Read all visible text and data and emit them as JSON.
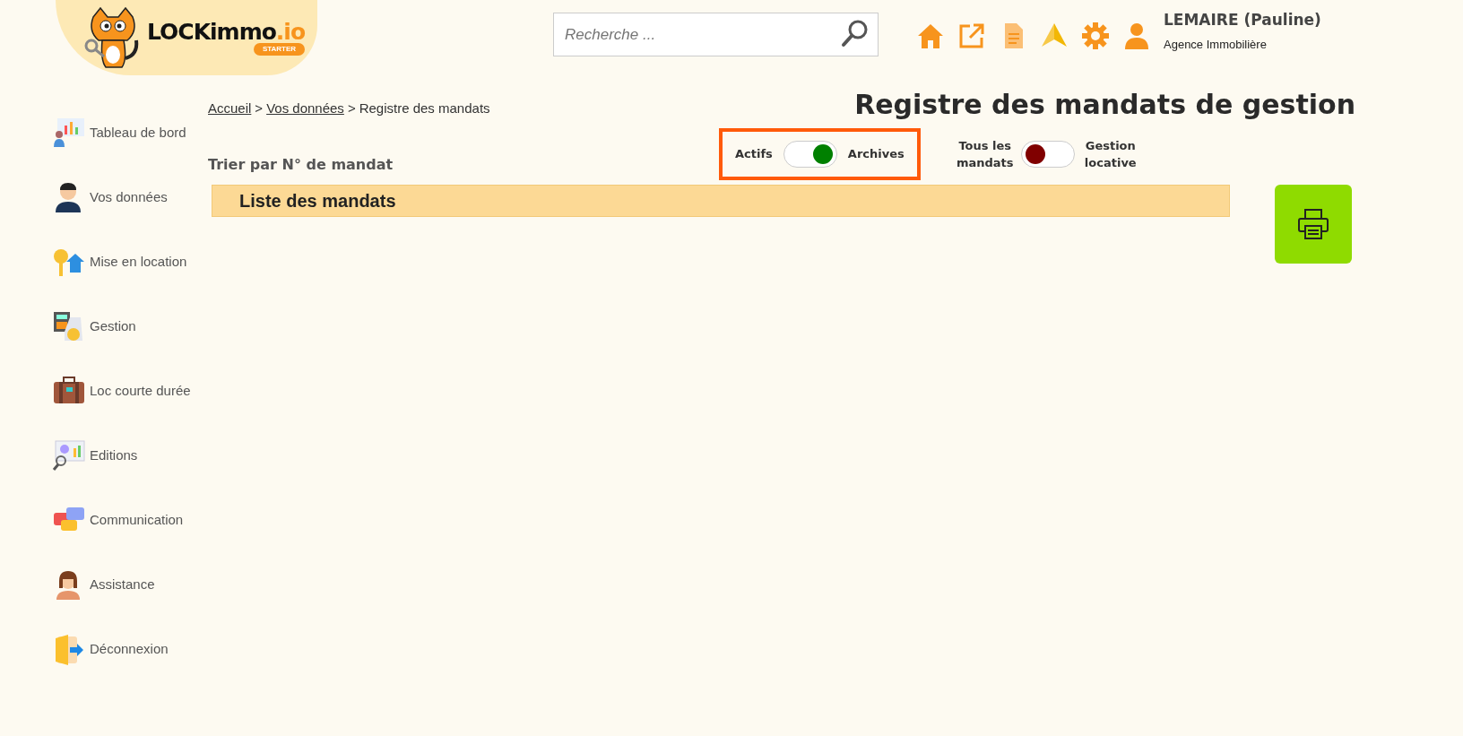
{
  "logo": {
    "name": "LOCKimmo",
    "suffix": ".io",
    "badge": "STARTER"
  },
  "search": {
    "placeholder": "Recherche ..."
  },
  "user": {
    "name": "LEMAIRE (Pauline)",
    "role": "Agence Immobilière"
  },
  "sidebar": {
    "items": [
      {
        "label": "Tableau de bord"
      },
      {
        "label": "Vos données"
      },
      {
        "label": "Mise en location"
      },
      {
        "label": "Gestion"
      },
      {
        "label": "Loc courte durée"
      },
      {
        "label": "Editions"
      },
      {
        "label": "Communication"
      },
      {
        "label": "Assistance"
      },
      {
        "label": "Déconnexion"
      }
    ]
  },
  "breadcrumb": [
    {
      "label": "Accueil",
      "link": true
    },
    {
      "label": "Vos données",
      "link": true
    },
    {
      "label": "Registre des mandats",
      "link": false
    }
  ],
  "separator": ">",
  "page_title": "Registre des mandats de gestion",
  "sort_label": "Trier par N° de mandat",
  "toggles": [
    {
      "left": "Actifs",
      "right": "Archives",
      "on": true,
      "color": "#008000",
      "highlighted": true
    },
    {
      "left": "Tous les mandats",
      "right": "Gestion locative",
      "on": false,
      "color": "#800000",
      "highlighted": false
    }
  ],
  "list_header": "Liste des mandats"
}
